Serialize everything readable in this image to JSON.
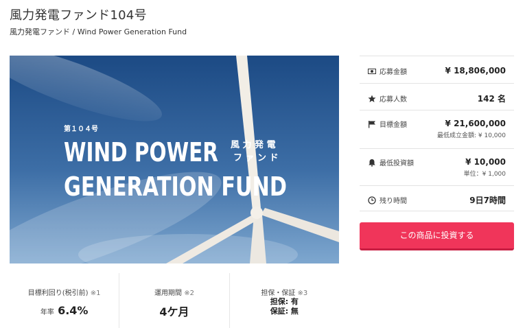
{
  "header": {
    "title": "風力発電ファンド104号",
    "subtitle": "風力発電ファンド / Wind Power Generation Fund"
  },
  "hero": {
    "badge": "第１０４号",
    "line1": "WIND POWER",
    "line2": "GENERATION FUND",
    "jp_line1": "風 力 発 電",
    "jp_line2": "フ ァ ン ド"
  },
  "panel": {
    "applied_amount": {
      "label": "応募金額",
      "value": "¥ 18,806,000",
      "icon": "money-icon"
    },
    "applicants": {
      "label": "応募人数",
      "value": "142 名",
      "icon": "star-icon"
    },
    "target_amount": {
      "label": "目標金額",
      "value": "¥ 21,600,000",
      "sub": "最低成立金額: ¥ 10,000",
      "icon": "flag-icon"
    },
    "min_investment": {
      "label": "最低投資額",
      "value": "¥ 10,000",
      "sub": "単位：¥ 1,000",
      "icon": "bell-icon"
    },
    "remaining": {
      "label": "残り時間",
      "value": "9日7時間",
      "icon": "clock-icon"
    }
  },
  "cta": {
    "label": "この商品に投資する"
  },
  "stats": {
    "yield": {
      "label": "目標利回り(税引前)",
      "note": "※1",
      "prefix": "年率",
      "value": "6.4%"
    },
    "period": {
      "label": "運用期間",
      "note": "※2",
      "value": "4ケ月"
    },
    "collateral": {
      "label": "担保・保証",
      "note": "※3",
      "line1": "担保: 有",
      "line2": "保証: 無"
    }
  },
  "colors": {
    "accent": "#f0355a",
    "sky_top": "#1d4f8a",
    "sky_bottom": "#6f9cc9"
  }
}
